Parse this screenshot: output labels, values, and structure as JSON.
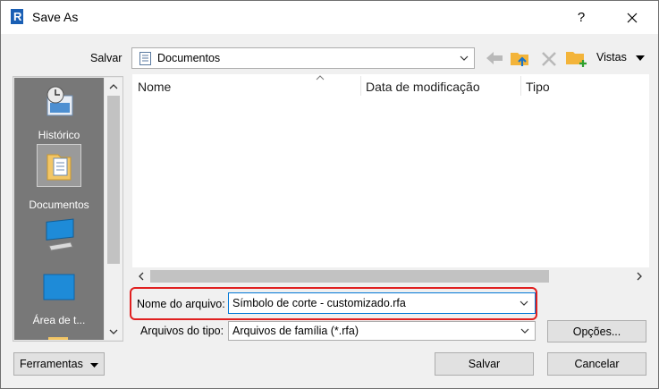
{
  "window": {
    "title": "Save As",
    "help": "?",
    "app_icon_letter": "R"
  },
  "location": {
    "label": "Salvar",
    "value": "Documentos",
    "views_label": "Vistas"
  },
  "places": [
    {
      "label": "Histórico",
      "icon": "history-icon"
    },
    {
      "label": "Documentos",
      "icon": "documents-folder-icon",
      "selected": true
    },
    {
      "label": "",
      "icon": "computer-icon"
    },
    {
      "label": "Área de t...",
      "icon": "desktop-icon"
    }
  ],
  "filelist": {
    "columns": [
      "Nome",
      "Data de modificação",
      "Tipo"
    ],
    "rows": []
  },
  "filename": {
    "label": "Nome do arquivo:",
    "value": "Símbolo de corte - customizado.rfa"
  },
  "filetype": {
    "label": "Arquivos do tipo:",
    "value": "Arquivos de família  (*.rfa)"
  },
  "buttons": {
    "options": "Opções...",
    "save": "Salvar",
    "cancel": "Cancelar",
    "tools": "Ferramentas"
  },
  "colors": {
    "highlight": "#e02020",
    "places_bg": "#787878",
    "focus_border": "#0078d7"
  }
}
